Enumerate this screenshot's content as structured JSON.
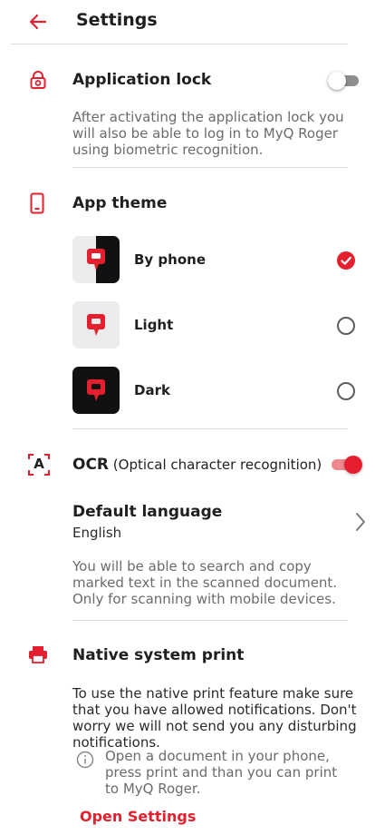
{
  "header": {
    "title": "Settings",
    "back_icon": "arrow-left-icon"
  },
  "colors": {
    "accent": "#e5202e",
    "text": "#1f1f1f",
    "muted": "#6b6b6b",
    "divider": "#dcdcdc"
  },
  "app_lock": {
    "icon": "lock-icon",
    "title": "Application lock",
    "enabled": false,
    "description": "After activating the application lock you will also be able to log in to MyQ Roger using biometric recognition."
  },
  "app_theme": {
    "icon": "phone-icon",
    "title": "App theme",
    "options": [
      {
        "label": "By phone",
        "selected": true,
        "variant": "split"
      },
      {
        "label": "Light",
        "selected": false,
        "variant": "light"
      },
      {
        "label": "Dark",
        "selected": false,
        "variant": "dark"
      }
    ]
  },
  "ocr": {
    "icon": "ocr-icon",
    "icon_text": "A",
    "title_bold": "OCR",
    "title_rest": " (Optical character recognition)",
    "enabled": true,
    "default_language": {
      "title": "Default language",
      "value": "English"
    },
    "description": "You will be able to search and copy marked text in the scanned document. Only for scanning with mobile devices."
  },
  "native_print": {
    "icon": "printer-icon",
    "title": "Native system print",
    "description": "To use the native print feature make sure that you have allowed notifications. Don't worry we will not send you any disturbing notifications.",
    "info_icon": "info-icon",
    "info": "Open a document in your phone, press print and than you can print to MyQ Roger.",
    "link": "Open Settings"
  }
}
